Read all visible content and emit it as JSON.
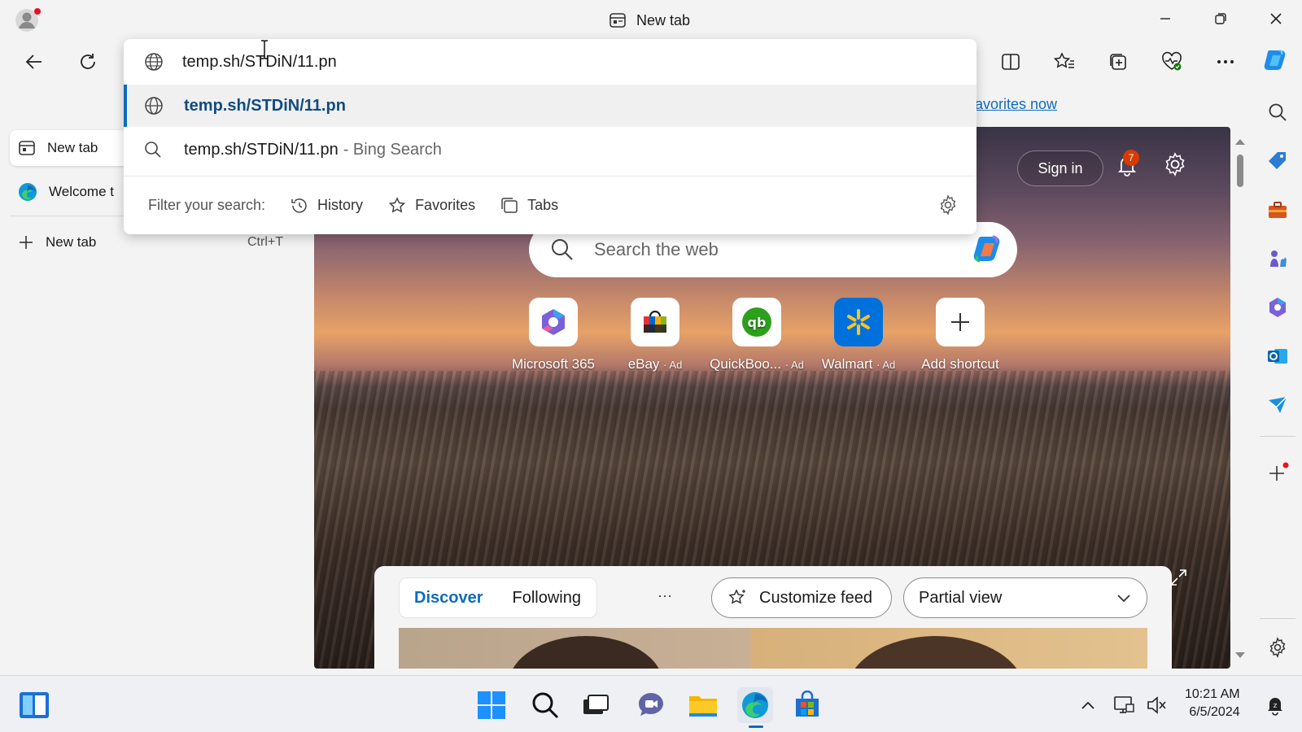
{
  "window": {
    "title": "New tab"
  },
  "toolbar": {
    "favorites_link": "avorites now"
  },
  "omnibox": {
    "value": "temp.sh/STDiN/11.pn",
    "suggestions": [
      {
        "text": "temp.sh/STDiN/11.pn",
        "suffix": ""
      },
      {
        "text": "temp.sh/STDiN/11.pn",
        "suffix": "- Bing Search"
      }
    ],
    "filter_label": "Filter your search:",
    "filters": [
      "History",
      "Favorites",
      "Tabs"
    ]
  },
  "side_tabs": {
    "tabs": [
      {
        "label": "New tab"
      },
      {
        "label": "Welcome t"
      }
    ],
    "new_tab_label": "New tab",
    "new_tab_shortcut": "Ctrl+T"
  },
  "ntp": {
    "sign_in": "Sign in",
    "notification_count": "7",
    "search_placeholder": "Search the web",
    "shortcuts": [
      {
        "label": "Microsoft 365",
        "ad": ""
      },
      {
        "label": "eBay",
        "ad": "· Ad"
      },
      {
        "label": "QuickBoo...",
        "ad": "· Ad"
      },
      {
        "label": "Walmart",
        "ad": "· Ad"
      },
      {
        "label": "Add shortcut",
        "ad": ""
      }
    ],
    "feed": {
      "tabs": [
        "Discover",
        "Following"
      ],
      "more": "···",
      "customize": "Customize feed",
      "view": "Partial view"
    }
  },
  "taskbar": {
    "time": "10:21 AM",
    "date": "6/5/2024"
  },
  "colors": {
    "accent": "#0f6cbd",
    "badge": "#d83b01"
  }
}
